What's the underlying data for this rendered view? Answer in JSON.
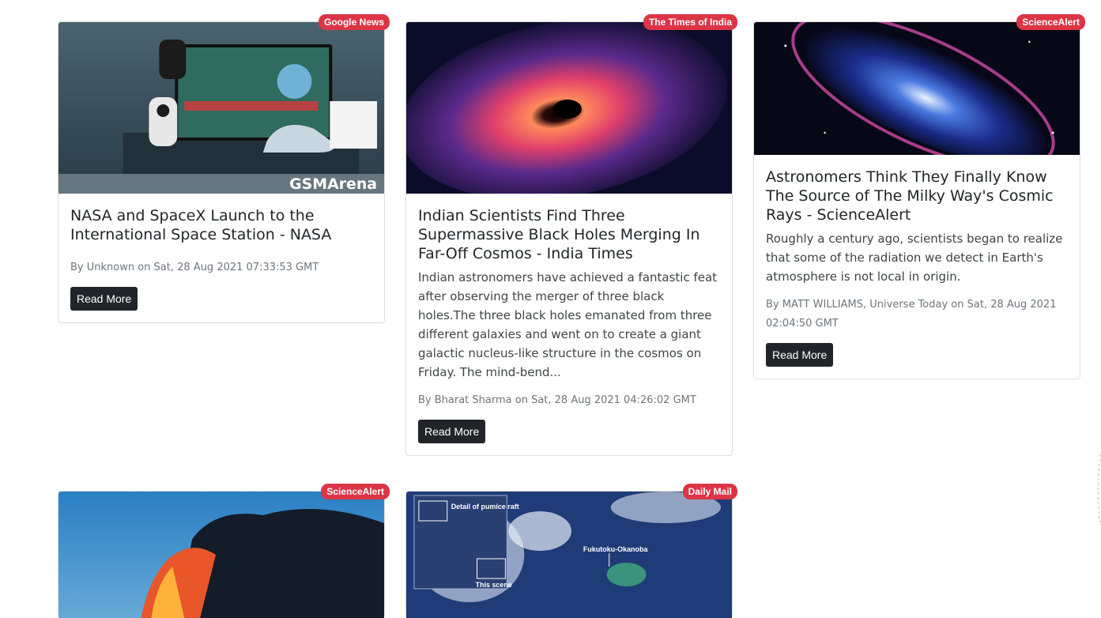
{
  "cards": [
    {
      "source": "Google News",
      "title": "NASA and SpaceX Launch to the International Space Station - NASA",
      "description": "",
      "meta": "By Unknown on Sat, 28 Aug 2021 07:33:53 GMT",
      "button": "Read More",
      "image_caption": "GSMArena"
    },
    {
      "source": "The Times of India",
      "title": "Indian Scientists Find Three Supermassive Black Holes Merging In Far-Off Cosmos - India Times",
      "description": "Indian astronomers have achieved a fantastic feat after observing the merger of three black holes.The three black holes emanated from three different galaxies and went on to create a giant galactic nucleus-like structure in the cosmos on Friday. The mind-bend...",
      "meta": "By Bharat Sharma on Sat, 28 Aug 2021 04:26:02 GMT",
      "button": "Read More"
    },
    {
      "source": "ScienceAlert",
      "title": "Astronomers Think They Finally Know The Source of The Milky Way's Cosmic Rays - ScienceAlert",
      "description": "Roughly a century ago, scientists began to realize that some of the radiation we detect in Earth's atmosphere is not local in origin.",
      "meta": "By MATT WILLIAMS, Universe Today on Sat, 28 Aug 2021 02:04:50 GMT",
      "button": "Read More"
    },
    {
      "source": "ScienceAlert"
    },
    {
      "source": "Daily Mail",
      "image_labels": [
        "Detail of pumice raft",
        "This scene",
        "Fukutoku-Okanoba"
      ]
    }
  ]
}
